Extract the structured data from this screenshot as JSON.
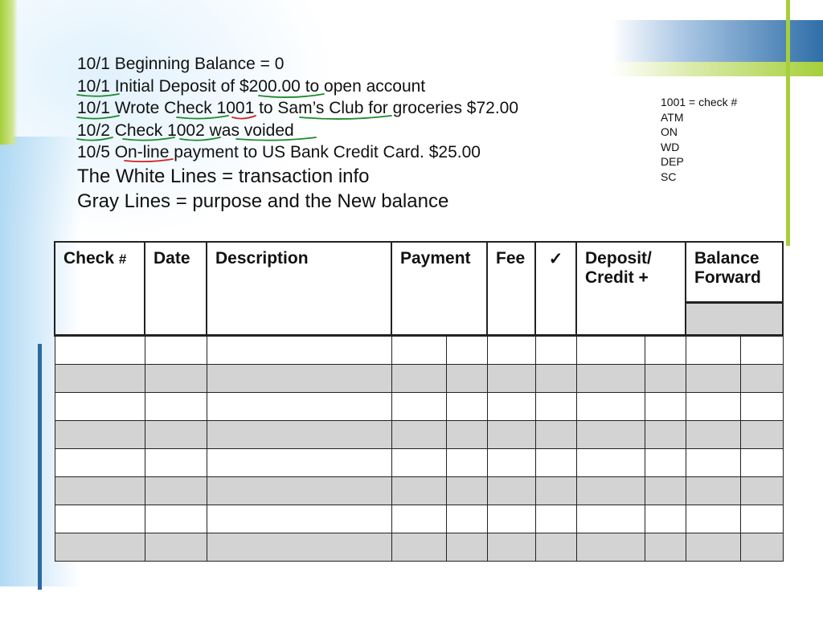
{
  "notes": [
    "10/1 Beginning Balance = 0",
    "10/1  Initial Deposit of $200.00 to open account",
    "10/1  Wrote Check 1001 to Sam’s Club for groceries  $72.00",
    "10/2  Check 1002 was voided",
    "10/5  On-line payment to US Bank Credit Card.  $25.00"
  ],
  "notes_large": [
    "The White Lines = transaction info",
    "Gray Lines =  purpose and the New balance"
  ],
  "legend": [
    "1001 = check  #",
    "ATM",
    "ON",
    "WD",
    "DEP",
    "SC"
  ],
  "table": {
    "headers": {
      "check": "Check",
      "check_hash": "#",
      "date": "Date",
      "description": "Description",
      "payment": "Payment",
      "fee": "Fee",
      "check_mark": "✓",
      "deposit_line1": "Deposit/",
      "deposit_line2": "Credit +",
      "balance_line1": "Balance",
      "balance_line2": "Forward"
    },
    "body_rows": [
      "white",
      "gray",
      "white",
      "gray",
      "white",
      "gray",
      "white",
      "gray"
    ]
  },
  "colors": {
    "accent_green": "#a6cf3b",
    "accent_blue": "#2f6ea8",
    "row_gray": "#d3d3d3",
    "annotation_green": "#1a8a2a",
    "annotation_red": "#d42020"
  }
}
